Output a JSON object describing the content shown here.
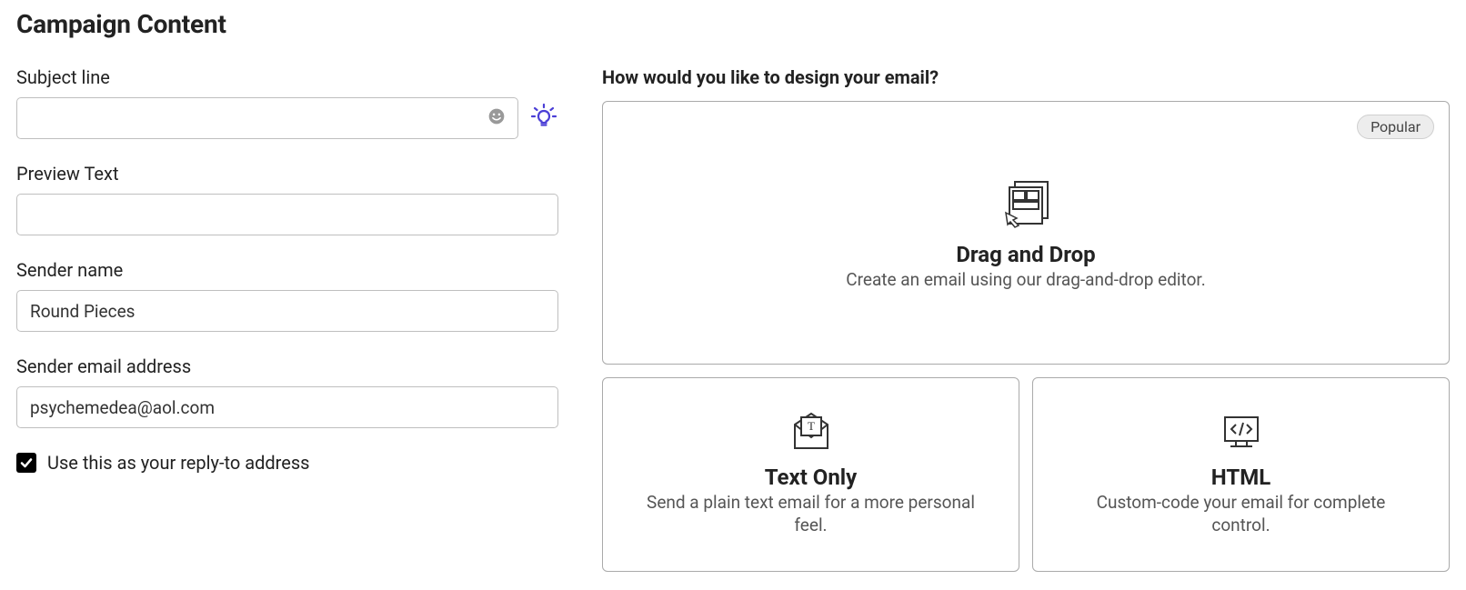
{
  "page_title": "Campaign Content",
  "left": {
    "subject": {
      "label": "Subject line",
      "value": ""
    },
    "preview": {
      "label": "Preview Text",
      "value": ""
    },
    "sender_name": {
      "label": "Sender name",
      "value": "Round Pieces"
    },
    "sender_email": {
      "label": "Sender email address",
      "value": "psychemedea@aol.com"
    },
    "reply_to_checkbox": {
      "checked": true,
      "label": "Use this as your reply-to address"
    }
  },
  "right": {
    "question": "How would you like to design your email?",
    "popular_badge": "Popular",
    "drag_drop": {
      "title": "Drag and Drop",
      "desc": "Create an email using our drag-and-drop editor."
    },
    "text_only": {
      "title": "Text Only",
      "desc": "Send a plain text email for a more personal feel."
    },
    "html": {
      "title": "HTML",
      "desc": "Custom-code your email for complete control."
    }
  }
}
